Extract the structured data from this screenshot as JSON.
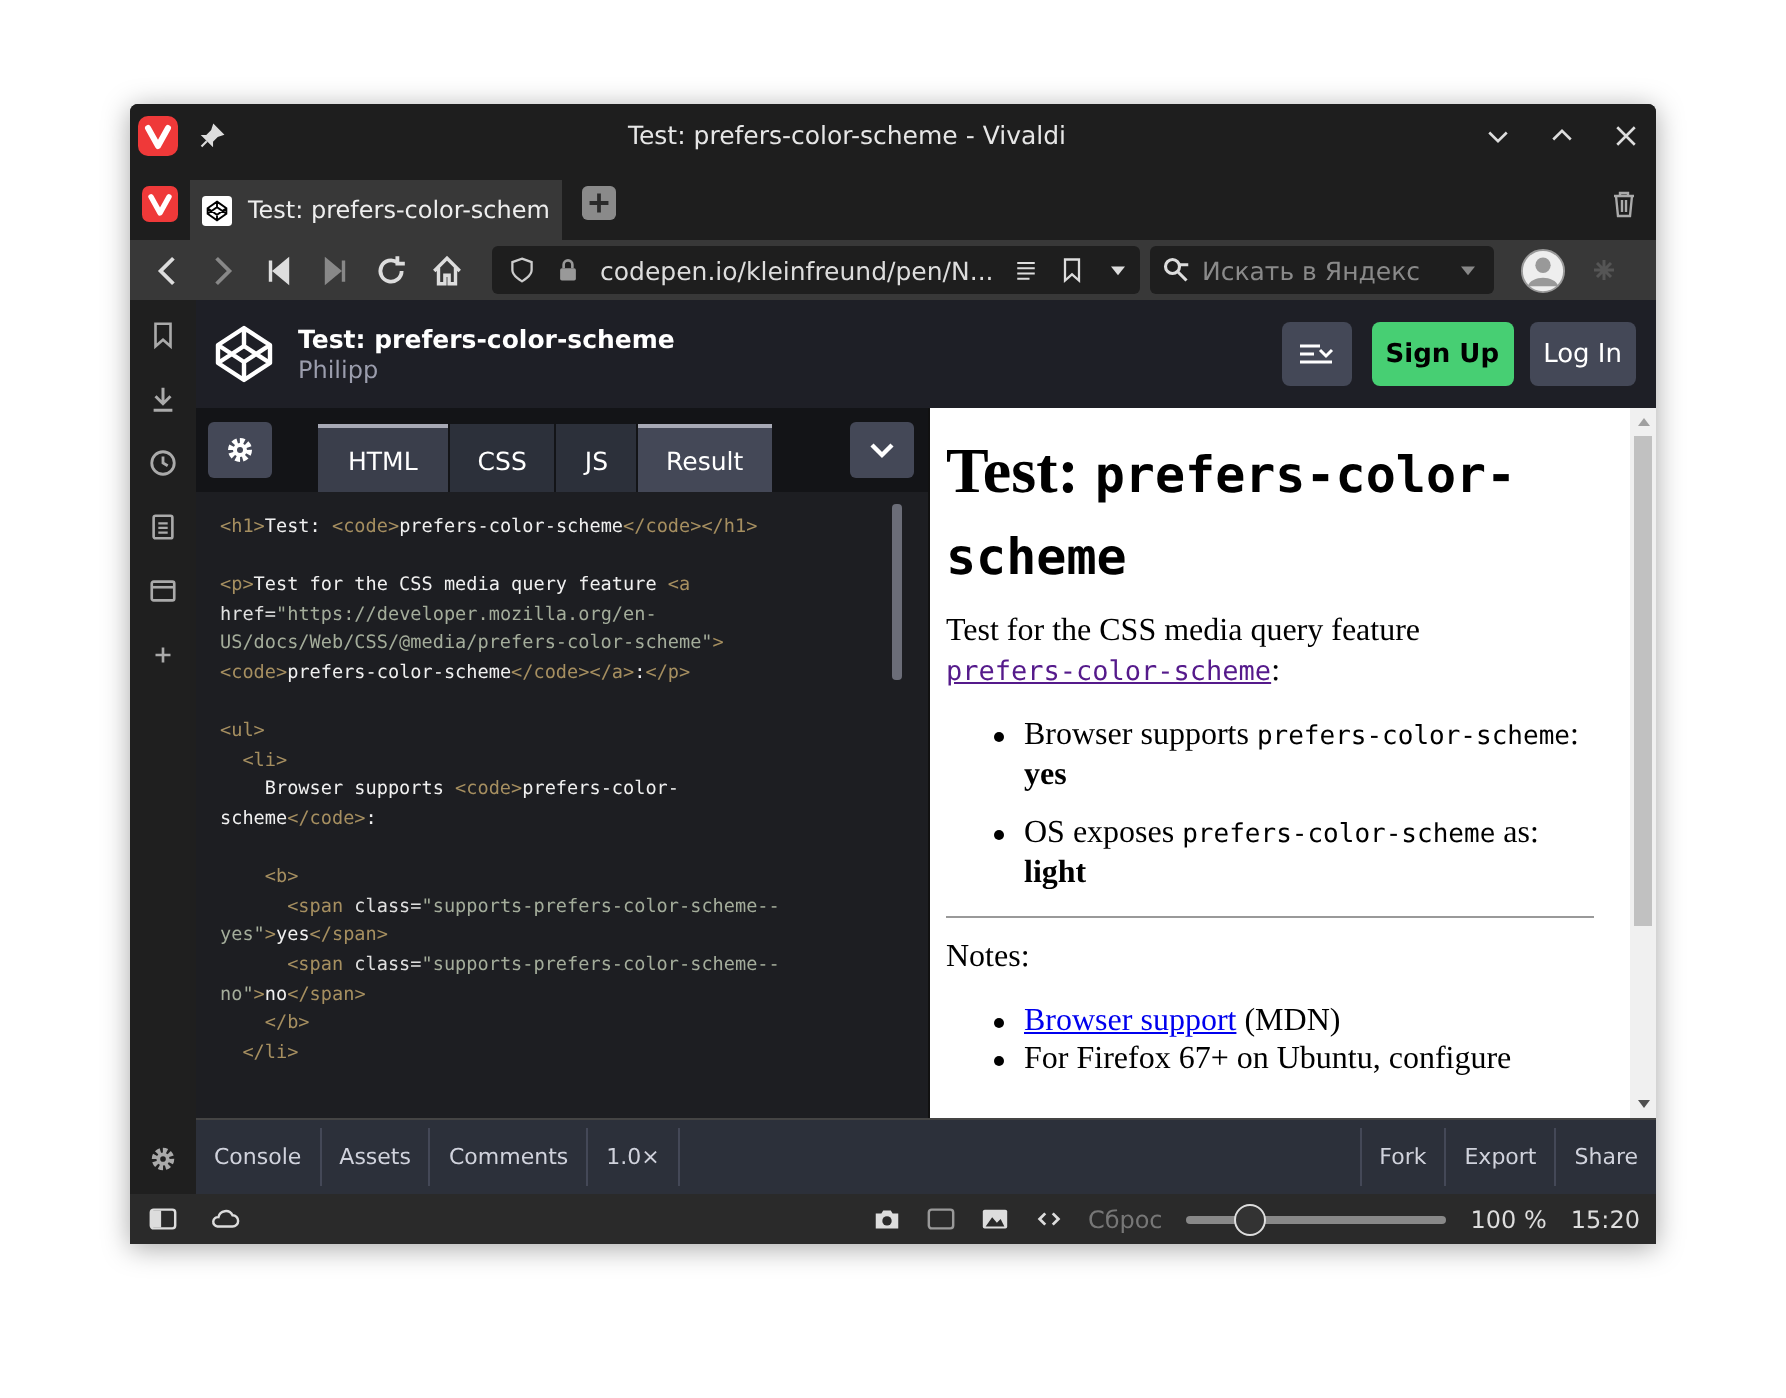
{
  "window": {
    "title": "Test: prefers-color-scheme - Vivaldi"
  },
  "tabs": [
    {
      "label": "Test: prefers-color-schem",
      "selected": true
    }
  ],
  "address_bar": {
    "url": "codepen.io/kleinfreund/pen/N..."
  },
  "search": {
    "placeholder": "Искать в Яндекс"
  },
  "pen": {
    "title": "Test: prefers-color-scheme",
    "author": "Philipp"
  },
  "header_buttons": [
    {
      "label": "Sign Up",
      "kind": "primary"
    },
    {
      "label": "Log In",
      "kind": "secondary"
    }
  ],
  "editor_tabs": [
    {
      "label": "HTML",
      "selected": true
    },
    {
      "label": "CSS",
      "selected": false
    },
    {
      "label": "JS",
      "selected": false
    },
    {
      "label": "Result",
      "selected": true
    }
  ],
  "code_lines": [
    {
      "kind": "code",
      "segments": [
        {
          "kind": "tag",
          "text": "<h1>"
        },
        {
          "kind": "text",
          "text": "Test: "
        },
        {
          "kind": "tag",
          "text": "<code>"
        },
        {
          "kind": "text",
          "text": "prefers-color-scheme"
        },
        {
          "kind": "tag",
          "text": "</code></h1>"
        }
      ]
    },
    {
      "kind": "blank"
    },
    {
      "kind": "code",
      "segments": [
        {
          "kind": "tag",
          "text": "<p>"
        },
        {
          "kind": "text",
          "text": "Test for the CSS media query feature "
        },
        {
          "kind": "tag",
          "text": "<a"
        }
      ]
    },
    {
      "kind": "code",
      "segments": [
        {
          "kind": "attr",
          "text": "href="
        },
        {
          "kind": "str",
          "text": "\"https://developer.mozilla.org/en-"
        }
      ]
    },
    {
      "kind": "code",
      "segments": [
        {
          "kind": "str",
          "text": "US/docs/Web/CSS/@media/prefers-color-scheme\""
        },
        {
          "kind": "tag",
          "text": ">"
        }
      ]
    },
    {
      "kind": "code",
      "segments": [
        {
          "kind": "tag",
          "text": "<code>"
        },
        {
          "kind": "text",
          "text": "prefers-color-scheme"
        },
        {
          "kind": "tag",
          "text": "</code></a>"
        },
        {
          "kind": "text",
          "text": ":"
        },
        {
          "kind": "tag",
          "text": "</p>"
        }
      ]
    },
    {
      "kind": "blank"
    },
    {
      "kind": "code",
      "segments": [
        {
          "kind": "tag",
          "text": "<ul>"
        }
      ]
    },
    {
      "kind": "code",
      "segments": [
        {
          "kind": "tag",
          "text": "  <li>"
        }
      ]
    },
    {
      "kind": "code",
      "segments": [
        {
          "kind": "text",
          "text": "    Browser supports "
        },
        {
          "kind": "tag",
          "text": "<code>"
        },
        {
          "kind": "text",
          "text": "prefers-color-"
        }
      ]
    },
    {
      "kind": "code",
      "segments": [
        {
          "kind": "text",
          "text": "scheme"
        },
        {
          "kind": "tag",
          "text": "</code>"
        },
        {
          "kind": "text",
          "text": ":"
        }
      ]
    },
    {
      "kind": "blank"
    },
    {
      "kind": "code",
      "segments": [
        {
          "kind": "tag",
          "text": "    <b>"
        }
      ]
    },
    {
      "kind": "code",
      "segments": [
        {
          "kind": "tag",
          "text": "      <span "
        },
        {
          "kind": "attr",
          "text": "class="
        },
        {
          "kind": "str",
          "text": "\"supports-prefers-color-scheme--"
        }
      ]
    },
    {
      "kind": "code",
      "segments": [
        {
          "kind": "str",
          "text": "yes\""
        },
        {
          "kind": "tag",
          "text": ">"
        },
        {
          "kind": "text",
          "text": "yes"
        },
        {
          "kind": "tag",
          "text": "</span>"
        }
      ]
    },
    {
      "kind": "code",
      "segments": [
        {
          "kind": "tag",
          "text": "      <span "
        },
        {
          "kind": "attr",
          "text": "class="
        },
        {
          "kind": "str",
          "text": "\"supports-prefers-color-scheme--"
        }
      ]
    },
    {
      "kind": "code",
      "segments": [
        {
          "kind": "str",
          "text": "no\""
        },
        {
          "kind": "tag",
          "text": ">"
        },
        {
          "kind": "text",
          "text": "no"
        },
        {
          "kind": "tag",
          "text": "</span>"
        }
      ]
    },
    {
      "kind": "code",
      "segments": [
        {
          "kind": "tag",
          "text": "    </b>"
        }
      ]
    },
    {
      "kind": "code",
      "segments": [
        {
          "kind": "tag",
          "text": "  </li>"
        }
      ]
    }
  ],
  "result": [
    {
      "kind": "heading",
      "parts": [
        {
          "kind": "text",
          "text": "Test: "
        },
        {
          "kind": "code",
          "text": "prefers-color-scheme"
        }
      ]
    },
    {
      "kind": "paragraph",
      "parts": [
        {
          "kind": "text",
          "text": "Test for the CSS media query feature "
        },
        {
          "kind": "codelink",
          "text": "prefers-color-scheme"
        },
        {
          "kind": "text",
          "text": ":"
        }
      ]
    },
    {
      "kind": "list",
      "items": [
        [
          {
            "kind": "text",
            "text": "Browser supports "
          },
          {
            "kind": "code",
            "text": "prefers-color-scheme"
          },
          {
            "kind": "text",
            "text": ": "
          },
          {
            "kind": "bold",
            "text": "yes"
          }
        ],
        [
          {
            "kind": "text",
            "text": "OS exposes "
          },
          {
            "kind": "code",
            "text": "prefers-color-scheme"
          },
          {
            "kind": "text",
            "text": " as: "
          },
          {
            "kind": "bold",
            "text": "light"
          }
        ]
      ]
    },
    {
      "kind": "rule"
    },
    {
      "kind": "paragraph",
      "parts": [
        {
          "kind": "text",
          "text": "Notes:"
        }
      ]
    },
    {
      "kind": "tightlist",
      "items": [
        [
          {
            "kind": "link",
            "text": "Browser support"
          },
          {
            "kind": "text",
            "text": " (MDN)"
          }
        ],
        [
          {
            "kind": "text",
            "text": "For Firefox 67+ on Ubuntu, configure"
          }
        ]
      ]
    }
  ],
  "bottom_left": [
    "Console",
    "Assets",
    "Comments",
    "1.0×"
  ],
  "bottom_right": [
    "Fork",
    "Export",
    "Share"
  ],
  "status_bar": {
    "reset": "Сброс",
    "zoom_slider": {
      "level": 0.2
    },
    "zoom": "100 %",
    "time": "15:20"
  }
}
